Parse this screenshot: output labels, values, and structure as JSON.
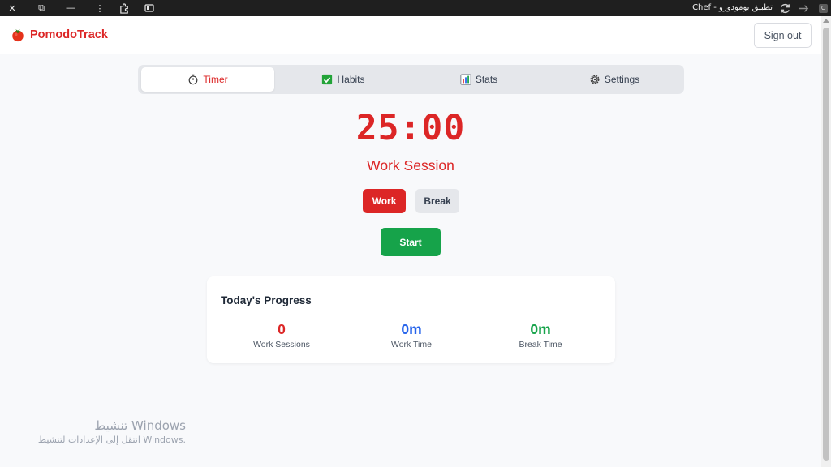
{
  "window": {
    "title": "Chef - تطبيق بومودورو",
    "close_glyph": "✕",
    "restore_glyph": "⧉",
    "minimize_glyph": "—",
    "menu_glyph": "⋮",
    "badge_label": "C"
  },
  "header": {
    "app_name": "PomodoTrack",
    "signout_label": "Sign out"
  },
  "tabs": [
    {
      "label": "Timer",
      "icon": "stopwatch-icon",
      "active": true
    },
    {
      "label": "Habits",
      "icon": "checkmark-box-icon",
      "active": false
    },
    {
      "label": "Stats",
      "icon": "bar-chart-icon",
      "active": false
    },
    {
      "label": "Settings",
      "icon": "gear-icon",
      "active": false
    }
  ],
  "timer": {
    "display": "25:00",
    "session_label": "Work Session",
    "modes": {
      "work": "Work",
      "break": "Break"
    },
    "start_label": "Start"
  },
  "progress": {
    "title": "Today's Progress",
    "stats": [
      {
        "value": "0",
        "label": "Work Sessions",
        "color": "#dc2626"
      },
      {
        "value": "0m",
        "label": "Work Time",
        "color": "#2563eb"
      },
      {
        "value": "0m",
        "label": "Break Time",
        "color": "#16a34a"
      }
    ]
  },
  "watermark": {
    "title": "تنشيط Windows",
    "subtitle": "انتقل إلى الإعدادات لتنشيط Windows."
  },
  "colors": {
    "brand": "#dc2626",
    "work_time": "#2563eb",
    "break_time": "#16a34a",
    "start_button": "#16a34a"
  }
}
